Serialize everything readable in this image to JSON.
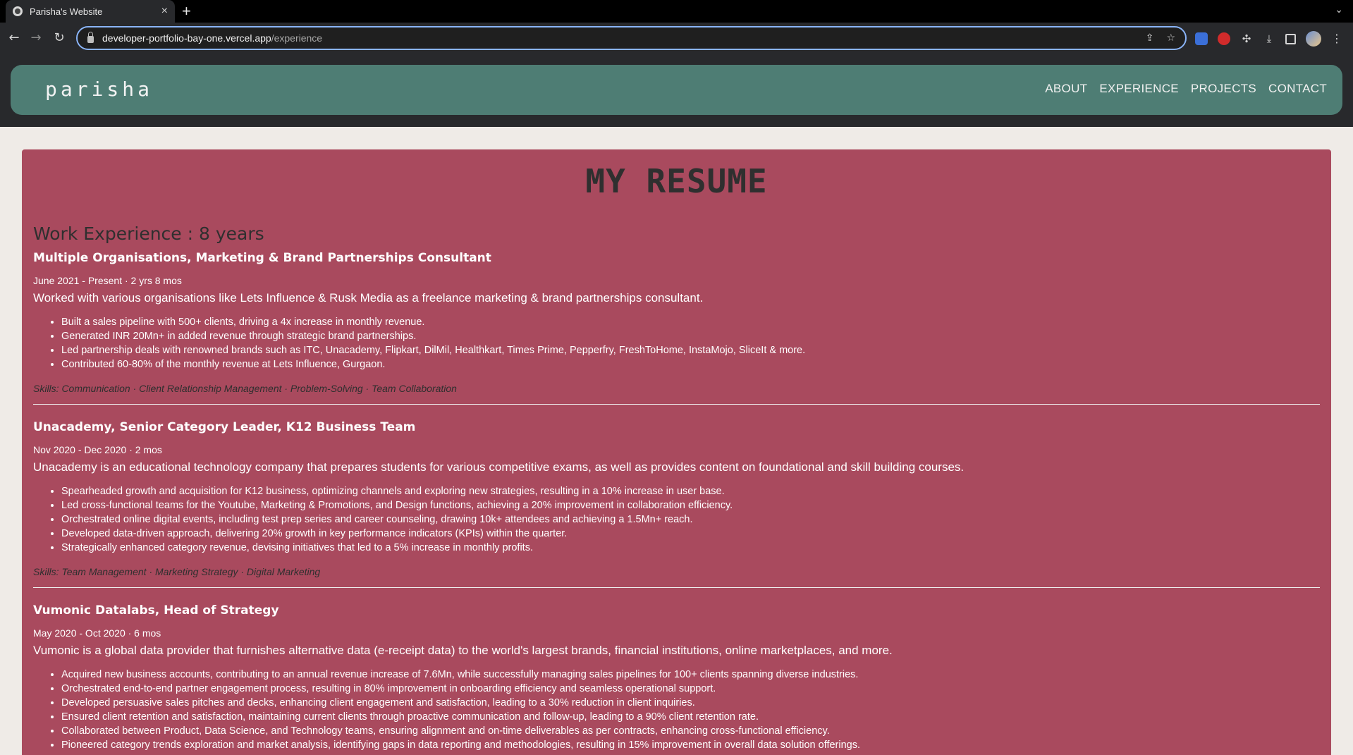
{
  "browser": {
    "tab_title": "Parisha's Website",
    "tab_close": "×",
    "new_tab": "+",
    "url_host": "developer-portfolio-bay-one.vercel.app",
    "url_path": "/experience"
  },
  "site": {
    "logo": "parisha",
    "nav": [
      "ABOUT",
      "EXPERIENCE",
      "PROJECTS",
      "CONTACT"
    ]
  },
  "resume": {
    "title": "MY RESUME",
    "experience_heading": "Work Experience : 8 years",
    "jobs": [
      {
        "title": "Multiple Organisations, Marketing & Brand Partnerships Consultant",
        "dates": "June 2021 - Present · 2 yrs 8 mos",
        "description": "Worked with various organisations like Lets Influence & Rusk Media as a freelance marketing & brand partnerships consultant.",
        "bullets": [
          "Built a sales pipeline with 500+ clients, driving a 4x increase in monthly revenue.",
          "Generated INR 20Mn+ in added revenue through strategic brand partnerships.",
          "Led partnership deals with renowned brands such as ITC, Unacademy, Flipkart, DilMil, Healthkart, Times Prime, Pepperfry, FreshToHome, InstaMojo, SliceIt & more.",
          "Contributed 60-80% of the monthly revenue at Lets Influence, Gurgaon."
        ],
        "skills": "Skills: Communication · Client Relationship Management · Problem-Solving · Team Collaboration"
      },
      {
        "title": "Unacademy, Senior Category Leader, K12 Business Team",
        "dates": "Nov 2020 - Dec 2020 · 2 mos",
        "description": "Unacademy is an educational technology company that prepares students for various competitive exams, as well as provides content on foundational and skill building courses.",
        "bullets": [
          "Spearheaded growth and acquisition for K12 business, optimizing channels and exploring new strategies, resulting in a 10% increase in user base.",
          "Led cross-functional teams for the Youtube, Marketing & Promotions, and Design functions, achieving a 20% improvement in collaboration efficiency.",
          "Orchestrated online digital events, including test prep series and career counseling, drawing 10k+ attendees and achieving a 1.5Mn+ reach.",
          "Developed data-driven approach, delivering 20% growth in key performance indicators (KPIs) within the quarter.",
          "Strategically enhanced category revenue, devising initiatives that led to a 5% increase in monthly profits."
        ],
        "skills": "Skills: Team Management · Marketing Strategy · Digital Marketing"
      },
      {
        "title": "Vumonic Datalabs, Head of Strategy",
        "dates": "May 2020 - Oct 2020 · 6 mos",
        "description": "Vumonic is a global data provider that furnishes alternative data (e-receipt data) to the world's largest brands, financial institutions, online marketplaces, and more.",
        "bullets": [
          "Acquired new business accounts, contributing to an annual revenue increase of 7.6Mn, while successfully managing sales pipelines for 100+ clients spanning diverse industries.",
          "Orchestrated end-to-end partner engagement process, resulting in 80% improvement in onboarding efficiency and seamless operational support.",
          "Developed persuasive sales pitches and decks, enhancing client engagement and satisfaction, leading to a 30% reduction in client inquiries.",
          "Ensured client retention and satisfaction, maintaining current clients through proactive communication and follow-up, leading to a 90% client retention rate.",
          "Collaborated between Product, Data Science, and Technology teams, ensuring alignment and on-time deliverables as per contracts, enhancing cross-functional efficiency.",
          "Pioneered category trends exploration and market analysis, identifying gaps in data reporting and methodologies, resulting in 15% improvement in overall data solution offerings."
        ],
        "skills": ""
      }
    ]
  }
}
